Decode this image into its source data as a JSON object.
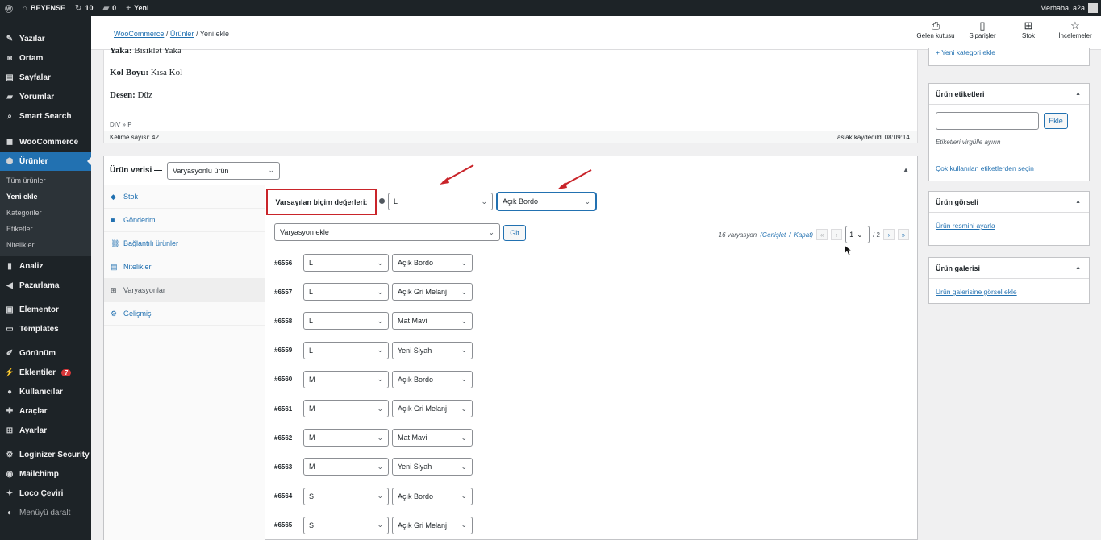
{
  "adminbar": {
    "wp_logo_icon": "wordpress-icon",
    "site_name": "BEYENSE",
    "updates_count": "10",
    "comments_count": "0",
    "new_label": "Yeni",
    "greeting": "Merhaba, a2a"
  },
  "sidebar": {
    "items_top": [
      {
        "icon": "pin-icon",
        "glyph": "✎",
        "label": "Yazılar"
      },
      {
        "icon": "media-icon",
        "glyph": "◙",
        "label": "Ortam"
      },
      {
        "icon": "page-icon",
        "glyph": "▤",
        "label": "Sayfalar"
      },
      {
        "icon": "comment-icon",
        "glyph": "▰",
        "label": "Yorumlar"
      },
      {
        "icon": "search-icon",
        "glyph": "⌕",
        "label": "Smart Search"
      }
    ],
    "woocommerce": {
      "icon": "woo-icon",
      "glyph": "◼",
      "label": "WooCommerce"
    },
    "products": {
      "icon": "box-icon",
      "glyph": "⬢",
      "label": "Ürünler"
    },
    "submenu": [
      "Tüm ürünler",
      "Yeni ekle",
      "Kategoriler",
      "Etiketler",
      "Nitelikler"
    ],
    "submenu_current": "Yeni ekle",
    "items_mid": [
      {
        "icon": "analytics-icon",
        "glyph": "▮",
        "label": "Analiz"
      },
      {
        "icon": "megaphone-icon",
        "glyph": "◀",
        "label": "Pazarlama"
      }
    ],
    "items_el": [
      {
        "icon": "elementor-icon",
        "glyph": "▣",
        "label": "Elementor"
      },
      {
        "icon": "folder-icon",
        "glyph": "▭",
        "label": "Templates"
      }
    ],
    "items_bottom": [
      {
        "icon": "brush-icon",
        "glyph": "✐",
        "label": "Görünüm"
      },
      {
        "icon": "plugin-icon",
        "glyph": "⚡",
        "label": "Eklentiler",
        "badge": "7"
      },
      {
        "icon": "users-icon",
        "glyph": "●",
        "label": "Kullanıcılar"
      },
      {
        "icon": "wrench-icon",
        "glyph": "✚",
        "label": "Araçlar"
      },
      {
        "icon": "settings-icon",
        "glyph": "⊞",
        "label": "Ayarlar"
      }
    ],
    "items_plugins": [
      {
        "icon": "gear-icon",
        "glyph": "⚙",
        "label": "Loginizer Security"
      },
      {
        "icon": "mailchimp-icon",
        "glyph": "◉",
        "label": "Mailchimp"
      },
      {
        "icon": "translate-icon",
        "glyph": "✦",
        "label": "Loco Çeviri"
      }
    ],
    "collapse": {
      "icon": "collapse-icon",
      "glyph": "◐",
      "label": "Menüyü daralt"
    }
  },
  "topbar": {
    "crumb_woo": "WooCommerce",
    "crumb_sep1": "/",
    "crumb_products": "Ürünler",
    "crumb_sep2": "/",
    "crumb_current": "Yeni ekle",
    "buttons": [
      {
        "icon": "inbox-icon",
        "glyph": "⎙",
        "label": "Gelen kutusu"
      },
      {
        "icon": "orders-icon",
        "glyph": "▯",
        "label": "Siparişler"
      },
      {
        "icon": "stock-icon",
        "glyph": "⊞",
        "label": "Stok"
      },
      {
        "icon": "star-icon",
        "glyph": "☆",
        "label": "İncelemeler"
      }
    ]
  },
  "editor": {
    "attr_partial_label": "Yaka:",
    "attr_partial_value": "Bisiklet Yaka",
    "attr2_label": "Kol Boyu:",
    "attr2_value": "Kısa Kol",
    "attr3_label": "Desen:",
    "attr3_value": "Düz",
    "path": "DIV » P",
    "word_count": "Kelime sayısı: 42",
    "draft_saved": "Taslak kaydedildi 08:09:14."
  },
  "product_data": {
    "title": "Ürün verisi —",
    "type_value": "Varyasyonlu ürün",
    "tabs": [
      {
        "icon": "stock-icon",
        "glyph": "◆",
        "label": "Stok"
      },
      {
        "icon": "truck-icon",
        "glyph": "■",
        "label": "Gönderim"
      },
      {
        "icon": "link-icon",
        "glyph": "⛓",
        "label": "Bağlantılı ürünler"
      },
      {
        "icon": "list-icon",
        "glyph": "▤",
        "label": "Nitelikler"
      },
      {
        "icon": "grid-icon",
        "glyph": "⊞",
        "label": "Varyasyonlar",
        "active": true
      },
      {
        "icon": "gear-icon",
        "glyph": "⚙",
        "label": "Gelişmiş"
      }
    ],
    "default_label": "Varsayılan biçim değerleri:",
    "default_size": "L",
    "default_color": "Açık Bordo",
    "add_variation": "Varyasyon ekle",
    "go_button": "Git",
    "variation_count": "16 varyasyon",
    "expand_label": "(Genişlet",
    "slash": "/",
    "close_label": "Kapat)",
    "page_first": "«",
    "page_prev": "‹",
    "current_page": "1",
    "total_pages": "/ 2",
    "page_next": "›",
    "page_last": "»",
    "variations": [
      {
        "id": "#6556",
        "size": "L",
        "color": "Açık Bordo"
      },
      {
        "id": "#6557",
        "size": "L",
        "color": "Açık Gri Melanj"
      },
      {
        "id": "#6558",
        "size": "L",
        "color": "Mat Mavi"
      },
      {
        "id": "#6559",
        "size": "L",
        "color": "Yeni Siyah"
      },
      {
        "id": "#6560",
        "size": "M",
        "color": "Açık Bordo"
      },
      {
        "id": "#6561",
        "size": "M",
        "color": "Açık Gri Melanj"
      },
      {
        "id": "#6562",
        "size": "M",
        "color": "Mat Mavi"
      },
      {
        "id": "#6563",
        "size": "M",
        "color": "Yeni Siyah"
      },
      {
        "id": "#6564",
        "size": "S",
        "color": "Açık Bordo"
      },
      {
        "id": "#6565",
        "size": "S",
        "color": "Açık Gri Melanj"
      }
    ]
  },
  "right": {
    "new_category": "+ Yeni kategori ekle",
    "tags_title": "Ürün etiketleri",
    "tags_add": "Ekle",
    "tags_hint": "Etiketleri virgülle ayırın",
    "tags_popular": "Çok kullanılan etiketlerden seçin",
    "image_title": "Ürün görseli",
    "image_link": "Ürün resmini ayarla",
    "gallery_title": "Ürün galerisi",
    "gallery_link": "Ürün galerisine görsel ekle"
  },
  "colors": {
    "accent": "#2271b1",
    "highlight_red": "#c9242a",
    "admin_dark": "#1d2327"
  }
}
